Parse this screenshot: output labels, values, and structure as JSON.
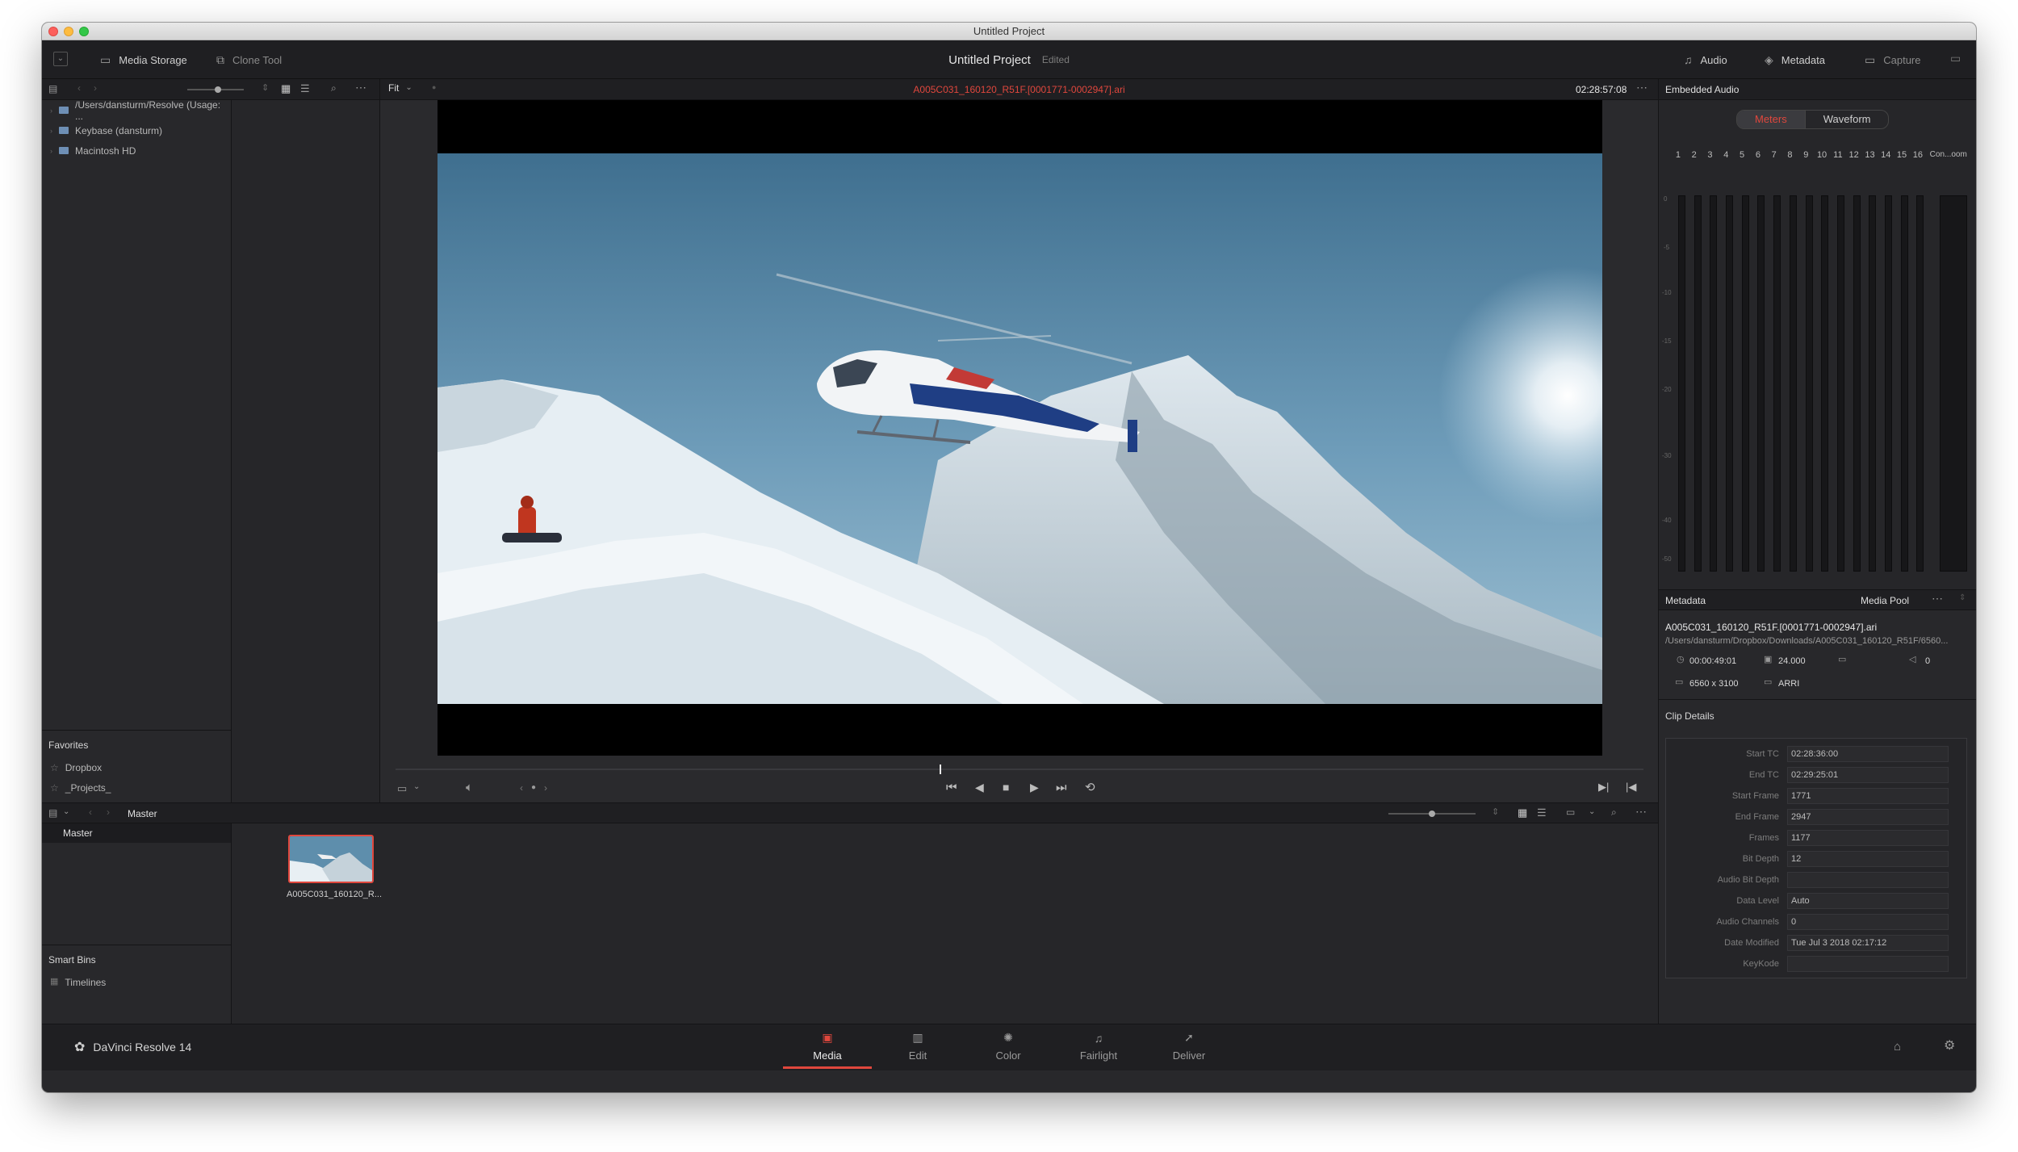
{
  "window": {
    "title": "Untitled Project"
  },
  "toolbar": {
    "media_storage": "Media Storage",
    "clone_tool": "Clone Tool",
    "project_title": "Untitled Project",
    "project_status": "Edited",
    "audio": "Audio",
    "metadata": "Metadata",
    "capture": "Capture"
  },
  "browser": {
    "locations": [
      "/Users/dansturm/Resolve (Usage: ...",
      "Keybase (dansturm)",
      "Macintosh HD"
    ],
    "favorites_title": "Favorites",
    "favorites": [
      "Dropbox",
      "_Projects_"
    ]
  },
  "viewer": {
    "zoom": "Fit",
    "clip_name": "A005C031_160120_R51F.[0001771-0002947].ari",
    "timecode": "02:28:57:08"
  },
  "audio_panel": {
    "title": "Embedded Audio",
    "tab_meters": "Meters",
    "tab_waveform": "Waveform",
    "channels": [
      "1",
      "2",
      "3",
      "4",
      "5",
      "6",
      "7",
      "8",
      "9",
      "10",
      "11",
      "12",
      "13",
      "14",
      "15",
      "16",
      "Con...oom"
    ],
    "scale": [
      "0",
      "-5",
      "-10",
      "-15",
      "-20",
      "-30",
      "-40",
      "-50"
    ]
  },
  "metadata_panel": {
    "title": "Metadata",
    "media_pool": "Media Pool",
    "clip_name": "A005C031_160120_R51F.[0001771-0002947].ari",
    "clip_path": "/Users/dansturm/Dropbox/Downloads/A005C031_160120_R51F/6560...",
    "duration": "00:00:49:01",
    "fps": "24.000",
    "audio_ch": "0",
    "resolution": "6560 x 3100",
    "codec": "ARRI",
    "clip_details_title": "Clip Details",
    "details": [
      {
        "label": "Start TC",
        "value": "02:28:36:00"
      },
      {
        "label": "End TC",
        "value": "02:29:25:01"
      },
      {
        "label": "Start Frame",
        "value": "1771"
      },
      {
        "label": "End Frame",
        "value": "2947"
      },
      {
        "label": "Frames",
        "value": "1177"
      },
      {
        "label": "Bit Depth",
        "value": "12"
      },
      {
        "label": "Audio Bit Depth",
        "value": ""
      },
      {
        "label": "Data Level",
        "value": "Auto"
      },
      {
        "label": "Audio Channels",
        "value": "0"
      },
      {
        "label": "Date Modified",
        "value": "Tue Jul 3 2018 02:17:12"
      },
      {
        "label": "KeyKode",
        "value": ""
      }
    ]
  },
  "media_pool": {
    "current_bin": "Master",
    "bins": [
      "Master"
    ],
    "smart_bins_title": "Smart Bins",
    "smart_bins": [
      "Timelines"
    ],
    "clip_thumb_label": "A005C031_160120_R..."
  },
  "footer": {
    "app_name": "DaVinci Resolve 14",
    "pages": [
      "Media",
      "Edit",
      "Color",
      "Fairlight",
      "Deliver"
    ],
    "active_page": "Media"
  },
  "colors": {
    "accent_red": "#e0473d",
    "panel_bg": "#28282b",
    "header_bg": "#1f1f22"
  }
}
